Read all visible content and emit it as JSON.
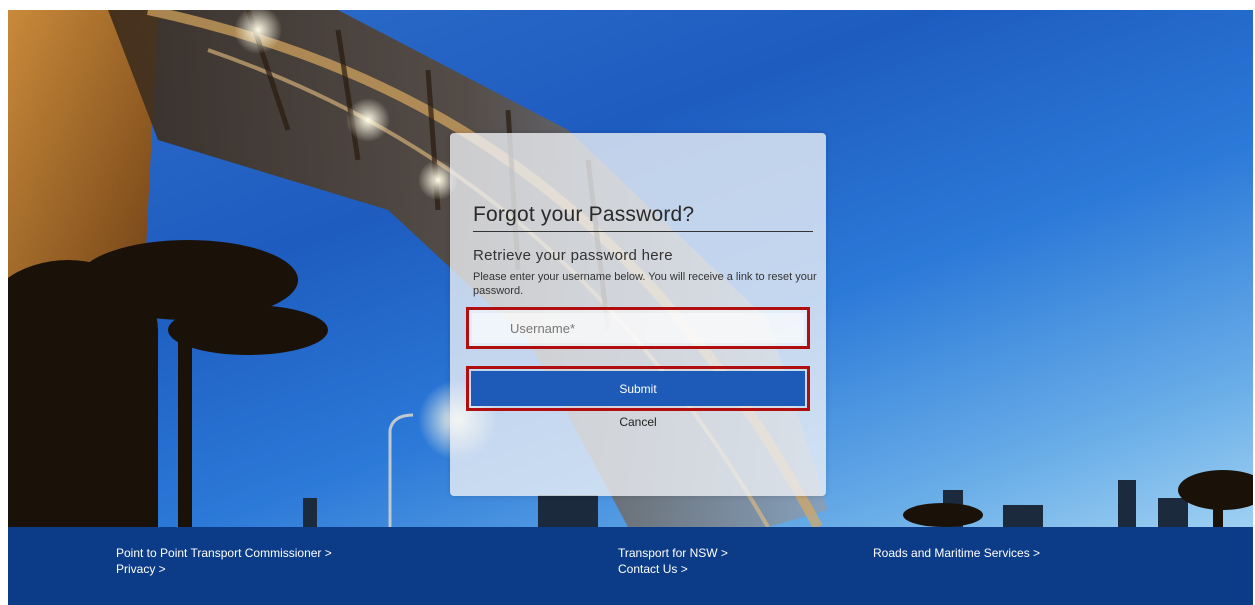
{
  "card": {
    "title": "Forgot your Password?",
    "subtitle": "Retrieve your password here",
    "description": "Please enter your username below. You will receive a link to reset your password.",
    "username_placeholder": "Username*",
    "submit_label": "Submit",
    "cancel_label": "Cancel"
  },
  "footer": {
    "links": [
      "Point to Point Transport Commissioner >",
      "Privacy >",
      "Transport for NSW >",
      "Contact Us >",
      "Roads and Maritime Services >"
    ]
  },
  "colors": {
    "footer_bg": "#0c3c87",
    "submit_bg": "#1e5bb8",
    "highlight_border": "#b10f0f",
    "sky": "#2b79d8"
  }
}
